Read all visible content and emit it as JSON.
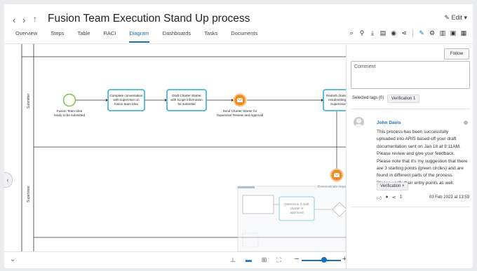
{
  "header": {
    "title": "Fusion Team Execution Stand Up process",
    "edit_label": "Edit",
    "tabs": [
      {
        "label": "Overview"
      },
      {
        "label": "Steps"
      },
      {
        "label": "Table"
      },
      {
        "label": "RACI"
      },
      {
        "label": "Diagram",
        "active": true
      },
      {
        "label": "Dashboards"
      },
      {
        "label": "Tasks"
      },
      {
        "label": "Documents"
      }
    ]
  },
  "diagram": {
    "lanes": [
      "Submitter",
      "Supervisor"
    ],
    "start_event_label": "Fusion Team Idea ready to be submitted",
    "tasks": [
      "Complete conversation with supervisor on fusion team idea",
      "Draft Charter Starter with scope information for submittal",
      "Redraft charte resubmitting Supervisor"
    ],
    "events": [
      "Send Charter Starter for Supervisor Review and Approval",
      "Communicate requirements"
    ],
    "minimap_task": "Determine if draft charter is approved"
  },
  "panel": {
    "follow_label": "Follow",
    "comment_placeholder": "Comment",
    "selected_tags_label": "Selected tags (0)",
    "tag_chip": "Verification  1",
    "comment": {
      "author": "John Davis",
      "body": "This process has been successfully uploaded into ARIS based off your draft documentation sent on Jan 18 at 9:11AM. Please review and give your feedback. Please note that it's my suggestion that there are 3 starting points (green circles) and are found in different parts of the process. Please verify their entry points as well.",
      "tag": "Verification ×",
      "reply_count": "1",
      "date": "03 Feb 2023 at 13:59"
    }
  },
  "colors": {
    "accent": "#1b6fb5",
    "start_event": "#7dc243",
    "intermediate_event": "#f08a1c",
    "task_border": "#2aa7d8"
  },
  "icons": [
    "back-icon",
    "forward-icon",
    "up-icon",
    "star-icon",
    "pencil-icon",
    "search-icon",
    "pin-icon",
    "download-icon",
    "print-icon",
    "share-icon",
    "collapse-icon",
    "left-arrow-icon",
    "chevron-down-icon"
  ]
}
